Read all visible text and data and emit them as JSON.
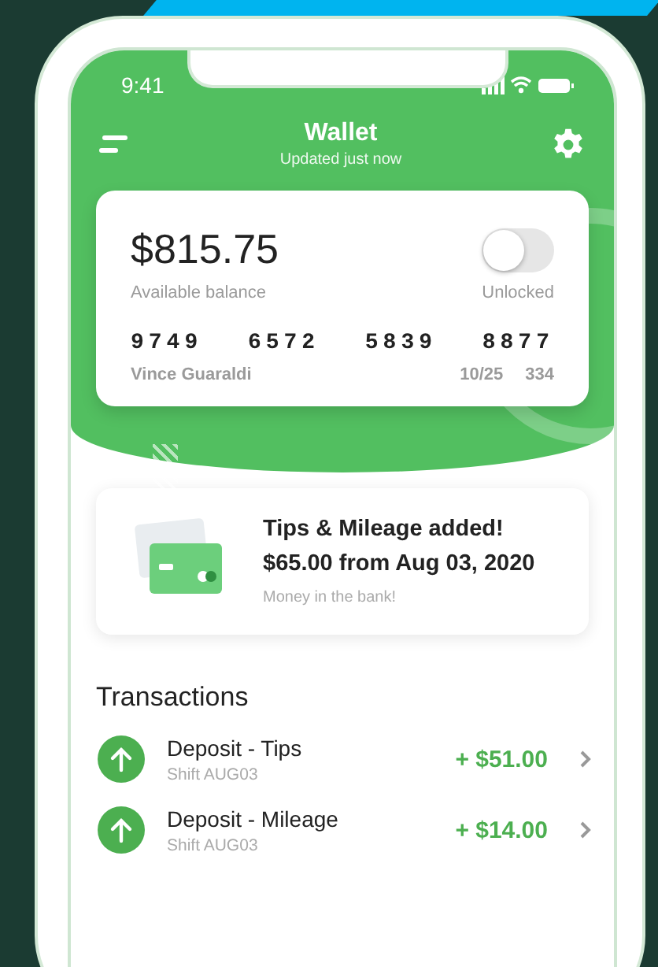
{
  "status_bar": {
    "time": "9:41"
  },
  "header": {
    "title": "Wallet",
    "subtitle": "Updated just now"
  },
  "card": {
    "balance": "$815.75",
    "balance_label": "Available balance",
    "lock_toggle": {
      "on": false,
      "label": "Unlocked"
    },
    "number_groups": [
      "9749",
      "6572",
      "5839",
      "8877"
    ],
    "holder": "Vince Guaraldi",
    "expiry": "10/25",
    "cvv": "334"
  },
  "notice": {
    "title": "Tips & Mileage added!",
    "amount_line": "$65.00 from Aug 03, 2020",
    "note": "Money in the bank!"
  },
  "transactions": {
    "heading": "Transactions",
    "items": [
      {
        "title": "Deposit - Tips",
        "subtitle": "Shift AUG03",
        "amount": "+ $51.00"
      },
      {
        "title": "Deposit - Mileage",
        "subtitle": "Shift AUG03",
        "amount": "+ $14.00"
      }
    ]
  }
}
